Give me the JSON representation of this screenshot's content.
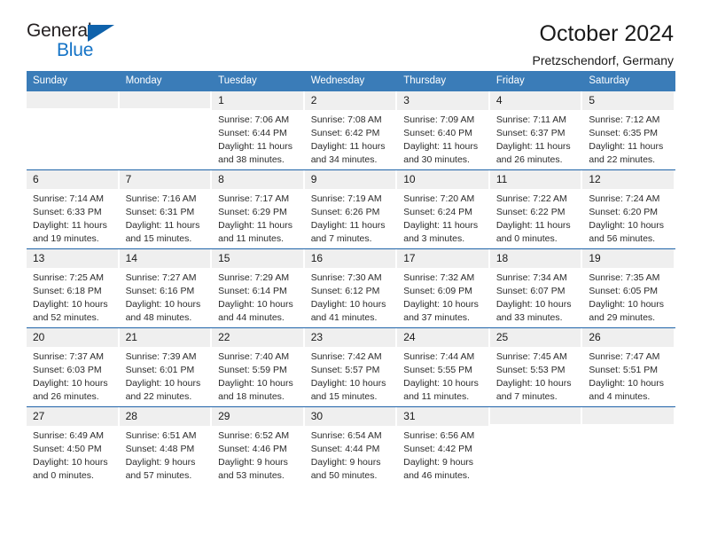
{
  "brand": {
    "name_top": "General",
    "name_bottom": "Blue",
    "accent_color": "#1473c6",
    "triangle_color": "#0f62ab"
  },
  "header": {
    "title": "October 2024",
    "subtitle": "Pretzschendorf, Germany"
  },
  "theme": {
    "header_blue": "#3a7cb8",
    "rule_blue": "#1f63a8",
    "daynum_gray": "#efefef"
  },
  "weekday_headers": [
    "Sunday",
    "Monday",
    "Tuesday",
    "Wednesday",
    "Thursday",
    "Friday",
    "Saturday"
  ],
  "labels": {
    "sunrise": "Sunrise:",
    "sunset": "Sunset:",
    "daylight": "Daylight:"
  },
  "weeks": [
    [
      {
        "day": "",
        "lines": []
      },
      {
        "day": "",
        "lines": []
      },
      {
        "day": "1",
        "lines": [
          "Sunrise: 7:06 AM",
          "Sunset: 6:44 PM",
          "Daylight: 11 hours",
          "and 38 minutes."
        ]
      },
      {
        "day": "2",
        "lines": [
          "Sunrise: 7:08 AM",
          "Sunset: 6:42 PM",
          "Daylight: 11 hours",
          "and 34 minutes."
        ]
      },
      {
        "day": "3",
        "lines": [
          "Sunrise: 7:09 AM",
          "Sunset: 6:40 PM",
          "Daylight: 11 hours",
          "and 30 minutes."
        ]
      },
      {
        "day": "4",
        "lines": [
          "Sunrise: 7:11 AM",
          "Sunset: 6:37 PM",
          "Daylight: 11 hours",
          "and 26 minutes."
        ]
      },
      {
        "day": "5",
        "lines": [
          "Sunrise: 7:12 AM",
          "Sunset: 6:35 PM",
          "Daylight: 11 hours",
          "and 22 minutes."
        ]
      }
    ],
    [
      {
        "day": "6",
        "lines": [
          "Sunrise: 7:14 AM",
          "Sunset: 6:33 PM",
          "Daylight: 11 hours",
          "and 19 minutes."
        ]
      },
      {
        "day": "7",
        "lines": [
          "Sunrise: 7:16 AM",
          "Sunset: 6:31 PM",
          "Daylight: 11 hours",
          "and 15 minutes."
        ]
      },
      {
        "day": "8",
        "lines": [
          "Sunrise: 7:17 AM",
          "Sunset: 6:29 PM",
          "Daylight: 11 hours",
          "and 11 minutes."
        ]
      },
      {
        "day": "9",
        "lines": [
          "Sunrise: 7:19 AM",
          "Sunset: 6:26 PM",
          "Daylight: 11 hours",
          "and 7 minutes."
        ]
      },
      {
        "day": "10",
        "lines": [
          "Sunrise: 7:20 AM",
          "Sunset: 6:24 PM",
          "Daylight: 11 hours",
          "and 3 minutes."
        ]
      },
      {
        "day": "11",
        "lines": [
          "Sunrise: 7:22 AM",
          "Sunset: 6:22 PM",
          "Daylight: 11 hours",
          "and 0 minutes."
        ]
      },
      {
        "day": "12",
        "lines": [
          "Sunrise: 7:24 AM",
          "Sunset: 6:20 PM",
          "Daylight: 10 hours",
          "and 56 minutes."
        ]
      }
    ],
    [
      {
        "day": "13",
        "lines": [
          "Sunrise: 7:25 AM",
          "Sunset: 6:18 PM",
          "Daylight: 10 hours",
          "and 52 minutes."
        ]
      },
      {
        "day": "14",
        "lines": [
          "Sunrise: 7:27 AM",
          "Sunset: 6:16 PM",
          "Daylight: 10 hours",
          "and 48 minutes."
        ]
      },
      {
        "day": "15",
        "lines": [
          "Sunrise: 7:29 AM",
          "Sunset: 6:14 PM",
          "Daylight: 10 hours",
          "and 44 minutes."
        ]
      },
      {
        "day": "16",
        "lines": [
          "Sunrise: 7:30 AM",
          "Sunset: 6:12 PM",
          "Daylight: 10 hours",
          "and 41 minutes."
        ]
      },
      {
        "day": "17",
        "lines": [
          "Sunrise: 7:32 AM",
          "Sunset: 6:09 PM",
          "Daylight: 10 hours",
          "and 37 minutes."
        ]
      },
      {
        "day": "18",
        "lines": [
          "Sunrise: 7:34 AM",
          "Sunset: 6:07 PM",
          "Daylight: 10 hours",
          "and 33 minutes."
        ]
      },
      {
        "day": "19",
        "lines": [
          "Sunrise: 7:35 AM",
          "Sunset: 6:05 PM",
          "Daylight: 10 hours",
          "and 29 minutes."
        ]
      }
    ],
    [
      {
        "day": "20",
        "lines": [
          "Sunrise: 7:37 AM",
          "Sunset: 6:03 PM",
          "Daylight: 10 hours",
          "and 26 minutes."
        ]
      },
      {
        "day": "21",
        "lines": [
          "Sunrise: 7:39 AM",
          "Sunset: 6:01 PM",
          "Daylight: 10 hours",
          "and 22 minutes."
        ]
      },
      {
        "day": "22",
        "lines": [
          "Sunrise: 7:40 AM",
          "Sunset: 5:59 PM",
          "Daylight: 10 hours",
          "and 18 minutes."
        ]
      },
      {
        "day": "23",
        "lines": [
          "Sunrise: 7:42 AM",
          "Sunset: 5:57 PM",
          "Daylight: 10 hours",
          "and 15 minutes."
        ]
      },
      {
        "day": "24",
        "lines": [
          "Sunrise: 7:44 AM",
          "Sunset: 5:55 PM",
          "Daylight: 10 hours",
          "and 11 minutes."
        ]
      },
      {
        "day": "25",
        "lines": [
          "Sunrise: 7:45 AM",
          "Sunset: 5:53 PM",
          "Daylight: 10 hours",
          "and 7 minutes."
        ]
      },
      {
        "day": "26",
        "lines": [
          "Sunrise: 7:47 AM",
          "Sunset: 5:51 PM",
          "Daylight: 10 hours",
          "and 4 minutes."
        ]
      }
    ],
    [
      {
        "day": "27",
        "lines": [
          "Sunrise: 6:49 AM",
          "Sunset: 4:50 PM",
          "Daylight: 10 hours",
          "and 0 minutes."
        ]
      },
      {
        "day": "28",
        "lines": [
          "Sunrise: 6:51 AM",
          "Sunset: 4:48 PM",
          "Daylight: 9 hours",
          "and 57 minutes."
        ]
      },
      {
        "day": "29",
        "lines": [
          "Sunrise: 6:52 AM",
          "Sunset: 4:46 PM",
          "Daylight: 9 hours",
          "and 53 minutes."
        ]
      },
      {
        "day": "30",
        "lines": [
          "Sunrise: 6:54 AM",
          "Sunset: 4:44 PM",
          "Daylight: 9 hours",
          "and 50 minutes."
        ]
      },
      {
        "day": "31",
        "lines": [
          "Sunrise: 6:56 AM",
          "Sunset: 4:42 PM",
          "Daylight: 9 hours",
          "and 46 minutes."
        ]
      },
      {
        "day": "",
        "lines": []
      },
      {
        "day": "",
        "lines": []
      }
    ]
  ]
}
